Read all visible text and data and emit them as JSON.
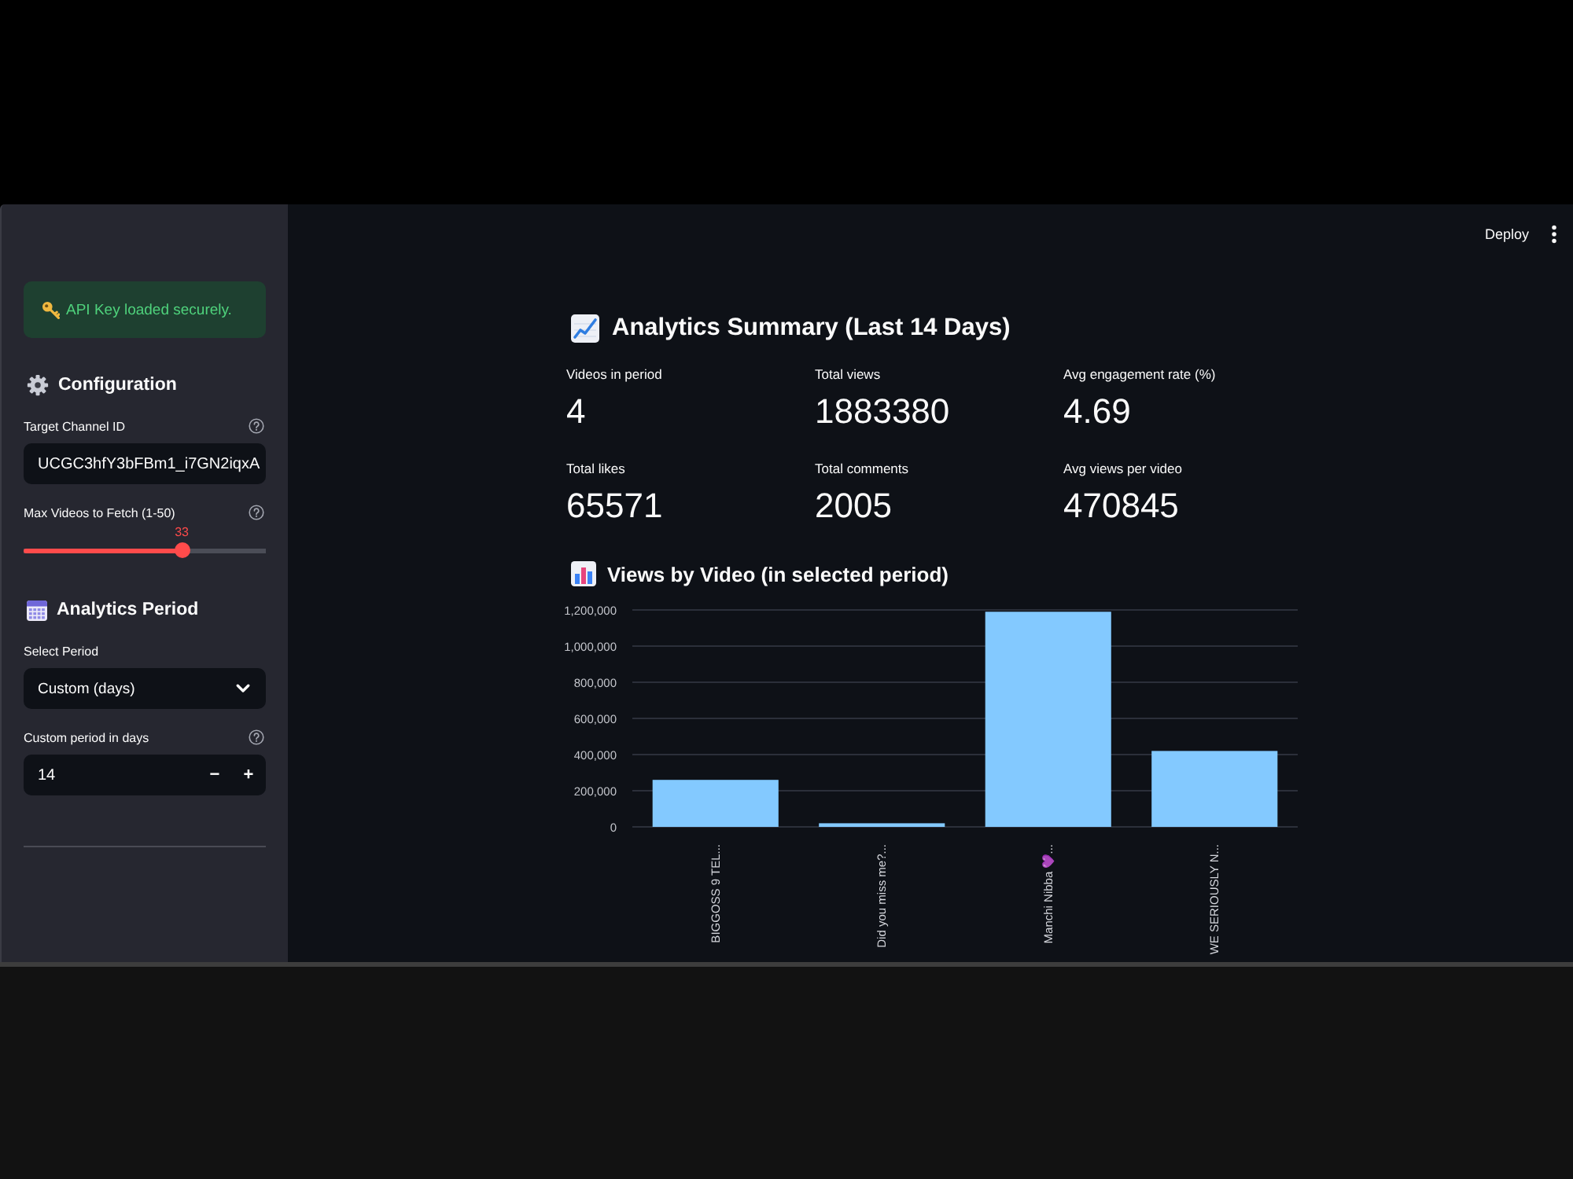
{
  "sidebar": {
    "alert": {
      "text": "API Key loaded securely."
    },
    "sections": [
      {
        "heading": "Configuration",
        "widgets": [
          {
            "kind": "text_input",
            "label": "Target Channel ID",
            "help": true,
            "value": "UCGC3hfY3bFBm1_i7GN2iqxA"
          },
          {
            "kind": "slider",
            "label": "Max Videos to Fetch (1-50)",
            "help": true,
            "reading": "33",
            "level": 0.653
          }
        ]
      },
      {
        "heading": "Analytics Period",
        "widgets": [
          {
            "kind": "select",
            "label": "Select Period",
            "help": false,
            "value": "Custom (days)"
          },
          {
            "kind": "number_input",
            "label": "Custom period in days",
            "help": true,
            "value": "14",
            "decrement": "−",
            "increment": "+"
          }
        ]
      }
    ]
  },
  "toolbar": {
    "deploy": "Deploy"
  },
  "summary": {
    "title": "Analytics Summary (Last 14 Days)",
    "metrics": [
      {
        "label": "Videos in period",
        "value": "4"
      },
      {
        "label": "Total views",
        "value": "1883380"
      },
      {
        "label": "Avg engagement rate (%)",
        "value": "4.69"
      },
      {
        "label": "Total likes",
        "value": "65571"
      },
      {
        "label": "Total comments",
        "value": "2005"
      },
      {
        "label": "Avg views per video",
        "value": "470845"
      }
    ]
  },
  "views": {
    "title": "Views by Video (in selected period)",
    "chart_data": {
      "type": "bar",
      "categories": [
        "BIGGOSS 9 TEL...",
        "Did you miss me?...",
        "Manchi Nibba 💜...",
        "WE SERIOUSLY N..."
      ],
      "values": [
        260000,
        20000,
        1190000,
        420000
      ],
      "ylim": [
        0,
        1200000
      ],
      "yticks": [
        0,
        {
          "value": 200000,
          "label": "200,000"
        },
        {
          "value": 400000,
          "label": "400,000"
        },
        {
          "value": 600000,
          "label": "600,000"
        },
        {
          "value": 800000,
          "label": "800,000"
        },
        {
          "value": 1000000,
          "label": "1,000,000"
        },
        {
          "value": 1200000,
          "label": "1,200,000"
        }
      ],
      "grid": true
    }
  }
}
